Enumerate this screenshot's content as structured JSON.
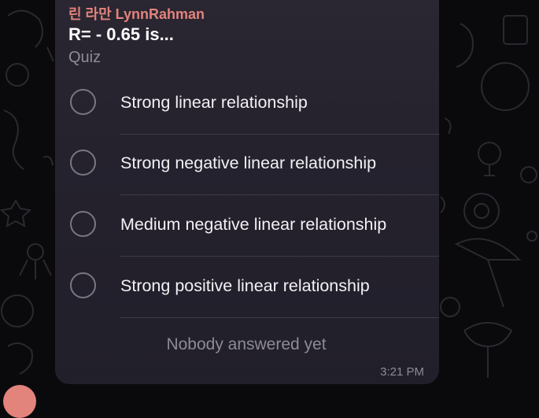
{
  "message": {
    "sender": "린 라만 LynnRahman",
    "question": "R= - 0.65 is...",
    "poll_type": "Quiz",
    "options": [
      {
        "label": "Strong linear relationship"
      },
      {
        "label": "Strong negative linear relationship"
      },
      {
        "label": "Medium negative linear relationship"
      },
      {
        "label": "Strong positive linear relationship"
      }
    ],
    "status": "Nobody answered yet",
    "time": "3:21 PM"
  },
  "colors": {
    "background": "#0a0a0c",
    "bubble": "#27242f",
    "sender": "#e2837c",
    "text": "#f2f1f4",
    "muted": "#8e8a96"
  },
  "icons": {
    "option_marker": "radio-circle-icon",
    "background_pattern": "doodle-pattern"
  }
}
